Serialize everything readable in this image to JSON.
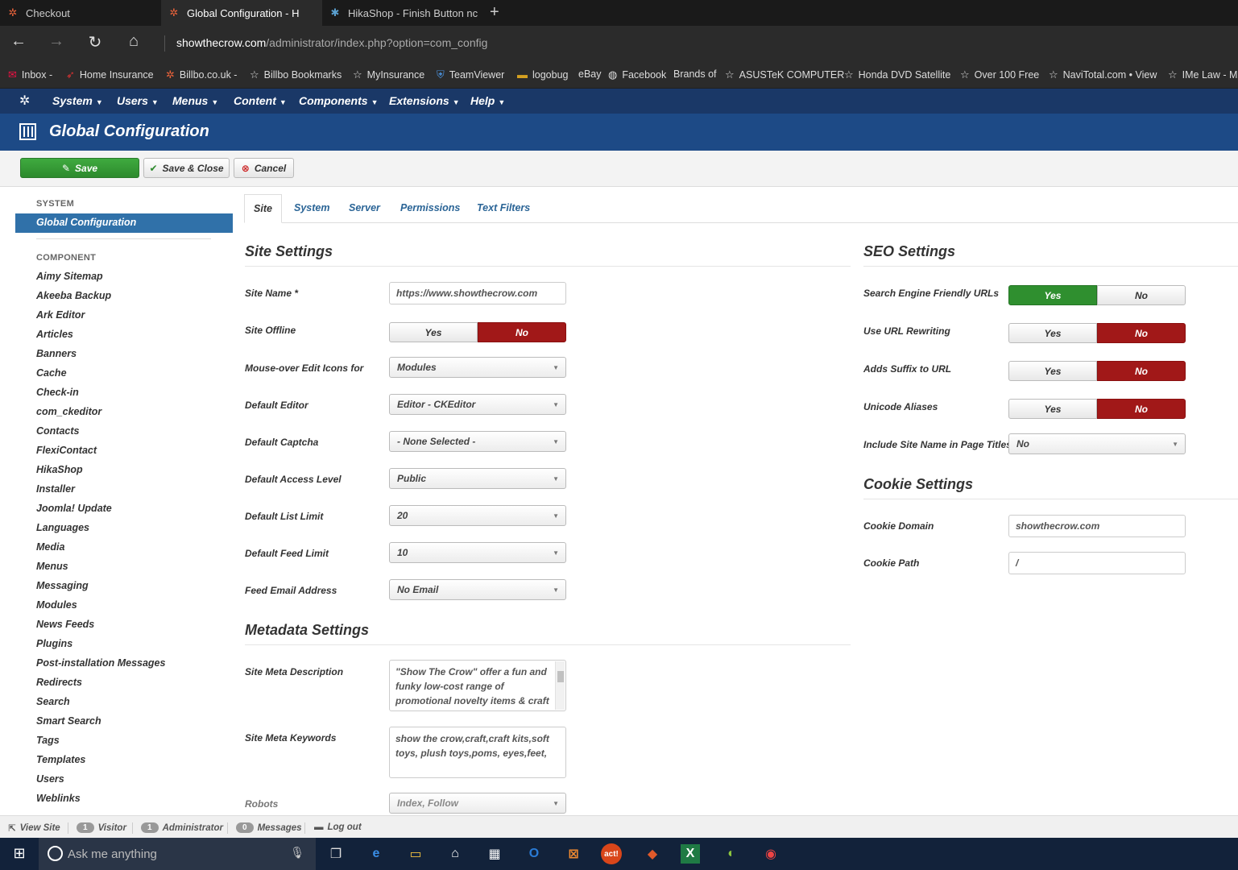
{
  "browser": {
    "tabs": [
      {
        "title": "Checkout",
        "icon": "joomla-icon",
        "active": false
      },
      {
        "title": "Global Configuration - H",
        "icon": "joomla-icon",
        "active": true
      },
      {
        "title": "HikaShop - Finish Button nc",
        "icon": "hikashop-icon",
        "active": false
      }
    ],
    "url_host": "showthecrow.com",
    "url_path": "/administrator/index.php?option=com_config",
    "favorites": [
      {
        "label": "Inbox -",
        "icon": "mail-icon"
      },
      {
        "label": "Home Insurance",
        "icon": "site-icon"
      },
      {
        "label": "Billbo.co.uk -",
        "icon": "joomla-icon"
      },
      {
        "label": "Billbo Bookmarks",
        "icon": "star-icon"
      },
      {
        "label": "MyInsurance",
        "icon": "star-icon"
      },
      {
        "label": "TeamViewer",
        "icon": "shield-icon"
      },
      {
        "label": "logobug",
        "icon": "flag-icon"
      },
      {
        "label": "eBay",
        "icon": ""
      },
      {
        "label": "Facebook",
        "icon": "globe-icon"
      },
      {
        "label": "Brands of",
        "icon": ""
      },
      {
        "label": "ASUSTeK COMPUTER",
        "icon": "star-icon"
      },
      {
        "label": "Honda DVD Satellite",
        "icon": "star-icon"
      },
      {
        "label": "Over 100 Free",
        "icon": "star-icon"
      },
      {
        "label": "NaviTotal.com • View",
        "icon": "star-icon"
      },
      {
        "label": "IMe Law - M",
        "icon": "star-icon"
      }
    ]
  },
  "admin_menu": [
    "System",
    "Users",
    "Menus",
    "Content",
    "Components",
    "Extensions",
    "Help"
  ],
  "page_title": "Global Configuration",
  "toolbar": {
    "save": "Save",
    "save_close": "Save & Close",
    "cancel": "Cancel"
  },
  "sidebar": {
    "system_heading": "SYSTEM",
    "active": "Global Configuration",
    "component_heading": "COMPONENT",
    "items": [
      "Aimy Sitemap",
      "Akeeba Backup",
      "Ark Editor",
      "Articles",
      "Banners",
      "Cache",
      "Check-in",
      "com_ckeditor",
      "Contacts",
      "FlexiContact",
      "HikaShop",
      "Installer",
      "Joomla! Update",
      "Languages",
      "Media",
      "Menus",
      "Messaging",
      "Modules",
      "News Feeds",
      "Plugins",
      "Post-installation Messages",
      "Redirects",
      "Search",
      "Smart Search",
      "Tags",
      "Templates",
      "Users",
      "Weblinks"
    ]
  },
  "tabs": [
    "Site",
    "System",
    "Server",
    "Permissions",
    "Text Filters"
  ],
  "site_settings": {
    "title": "Site Settings",
    "site_name_label": "Site Name *",
    "site_name_value": "https://www.showthecrow.com",
    "site_offline_label": "Site Offline",
    "mouseover_label": "Mouse-over Edit Icons for",
    "mouseover_value": "Modules",
    "default_editor_label": "Default Editor",
    "default_editor_value": "Editor - CKEditor",
    "default_captcha_label": "Default Captcha",
    "default_captcha_value": "- None Selected -",
    "access_level_label": "Default Access Level",
    "access_level_value": "Public",
    "list_limit_label": "Default List Limit",
    "list_limit_value": "20",
    "feed_limit_label": "Default Feed Limit",
    "feed_limit_value": "10",
    "feed_email_label": "Feed Email Address",
    "feed_email_value": "No Email"
  },
  "metadata_settings": {
    "title": "Metadata Settings",
    "description_label": "Site Meta Description",
    "description_value": "\"Show The Crow\" offer a fun and funky low-cost range of promotional novelty items & craft",
    "keywords_label": "Site Meta Keywords",
    "keywords_value": "show the crow,craft,craft kits,soft toys, plush toys,poms, eyes,feet,",
    "robots_label": "Robots",
    "robots_value": "Index, Follow"
  },
  "seo_settings": {
    "title": "SEO Settings",
    "sef_label": "Search Engine Friendly URLs",
    "rewrite_label": "Use URL Rewriting",
    "suffix_label": "Adds Suffix to URL",
    "unicode_label": "Unicode Aliases",
    "sitename_label": "Include Site Name in Page Titles",
    "sitename_value": "No"
  },
  "cookie_settings": {
    "title": "Cookie Settings",
    "domain_label": "Cookie Domain",
    "domain_value": "showthecrow.com",
    "path_label": "Cookie Path",
    "path_value": "/"
  },
  "toggle": {
    "yes": "Yes",
    "no": "No"
  },
  "colors": {
    "toggle_yes_active": "#2f8f2f",
    "toggle_no_active": "#a11818",
    "header": "#1d4a86",
    "menu": "#1a3867"
  },
  "statusbar": {
    "view_site": "View Site",
    "visitor_count": "1",
    "visitor_label": "Visitor",
    "admin_count": "1",
    "admin_label": "Administrator",
    "messages_count": "0",
    "messages_label": "Messages",
    "logout": "Log out"
  },
  "taskbar": {
    "search_placeholder": "Ask me anything"
  }
}
